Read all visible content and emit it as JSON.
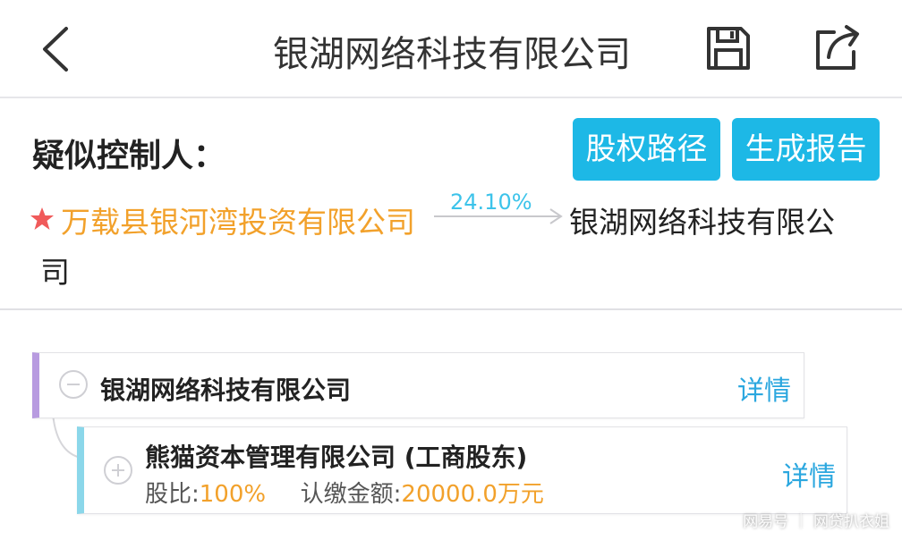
{
  "nav": {
    "title": "银湖网络科技有限公司",
    "back_icon": "chevron-left-icon",
    "save_icon": "floppy-disk-icon",
    "share_icon": "share-icon"
  },
  "controller": {
    "label": "疑似控制人：",
    "buttons": {
      "equity_path": "股权路径",
      "generate_report": "生成报告"
    },
    "holder_name": "万载县银河湾投资有限公司",
    "holding_percent": "24.10%",
    "target_line1": "银湖网络科技有限公",
    "target_line2": "司"
  },
  "tree": {
    "root": {
      "name": "银湖网络科技有限公司",
      "detail": "详情"
    },
    "child": {
      "name": "熊猫资本管理有限公司 (工商股东)",
      "share_label": "股比:",
      "share_value": "100%",
      "capital_label": "认缴金额:",
      "capital_value": "20000.0万元",
      "detail": "详情"
    }
  },
  "watermark": "网易号 ｜ 网贷扒衣姐",
  "colors": {
    "accent": "#1db8e6",
    "holder": "#f2a12b",
    "link": "#2ba7df",
    "root_bar": "#b89be0",
    "child_bar": "#8bd7ea",
    "star": "#f05a5a"
  }
}
